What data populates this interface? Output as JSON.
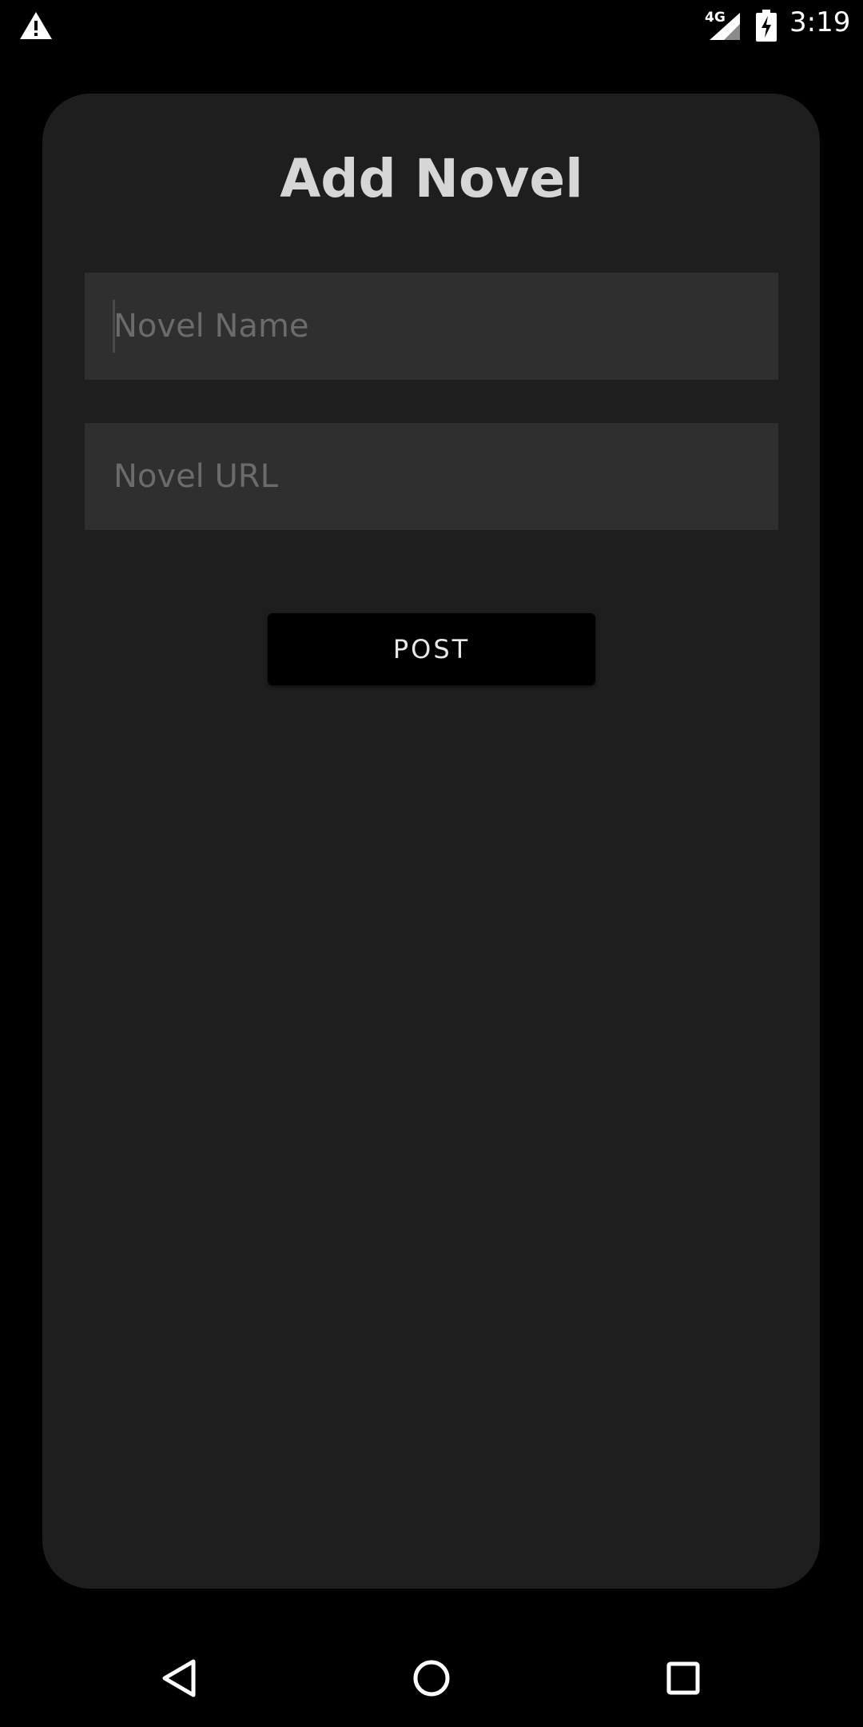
{
  "status_bar": {
    "alert_icon": "warning-triangle-icon",
    "network_type": "4G",
    "signal_icon": "cell-signal-icon",
    "battery_icon": "battery-charging-icon",
    "time": "3:19"
  },
  "form": {
    "title": "Add Novel",
    "novel_name": {
      "value": "",
      "placeholder": "Novel Name"
    },
    "novel_url": {
      "value": "",
      "placeholder": "Novel URL"
    },
    "post_label": "POST"
  },
  "nav_bar": {
    "back_icon": "back-triangle-icon",
    "home_icon": "home-circle-icon",
    "recents_icon": "recents-square-icon"
  },
  "colors": {
    "background": "#000000",
    "card": "#1e1e1e",
    "input": "#2f2f2f",
    "title_text": "#d6d6d6",
    "placeholder_text": "#6b6b6b",
    "button": "#000000"
  }
}
